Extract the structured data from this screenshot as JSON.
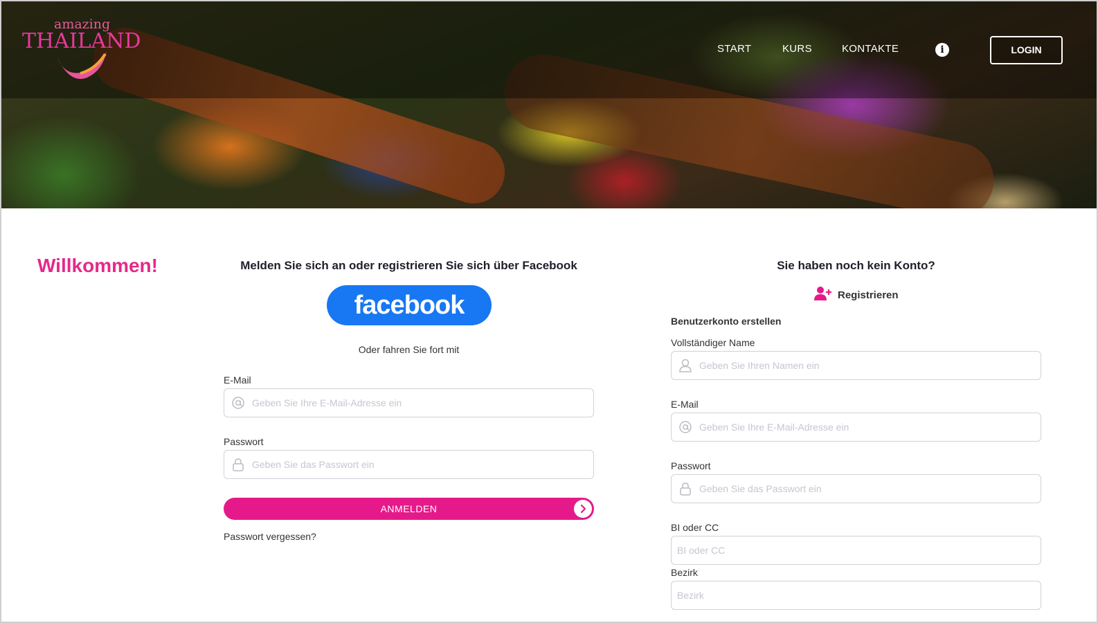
{
  "brand": {
    "logo_small": "amazing",
    "logo_big": "THAILAND"
  },
  "nav": {
    "start": "START",
    "kurs": "KURS",
    "kontakte": "KONTAKTE",
    "login": "LOGIN"
  },
  "welcome": "Willkommen!",
  "login": {
    "title": "Melden Sie sich an oder registrieren Sie sich über Facebook",
    "facebook_label": "facebook",
    "or_text": "Oder fahren Sie fort mit",
    "email_label": "E-Mail",
    "email_placeholder": "Geben Sie Ihre E-Mail-Adresse ein",
    "password_label": "Passwort",
    "password_placeholder": "Geben Sie das Passwort ein",
    "submit": "ANMELDEN",
    "forgot": "Passwort vergessen?"
  },
  "register": {
    "title": "Sie haben noch kein Konto?",
    "link": "Registrieren",
    "create_title": "Benutzerkonto erstellen",
    "name_label": "Vollständiger Name",
    "name_placeholder": "Geben Sie Ihren Namen ein",
    "email_label": "E-Mail",
    "email_placeholder": "Geben Sie Ihre E-Mail-Adresse ein",
    "password_label": "Passwort",
    "password_placeholder": "Geben Sie das Passwort ein",
    "bi_label": "BI oder CC",
    "bi_placeholder": "BI oder CC",
    "bezirk_label": "Bezirk",
    "bezirk_placeholder": "Bezirk"
  },
  "colors": {
    "accent": "#e6198a",
    "facebook": "#1877f2"
  }
}
